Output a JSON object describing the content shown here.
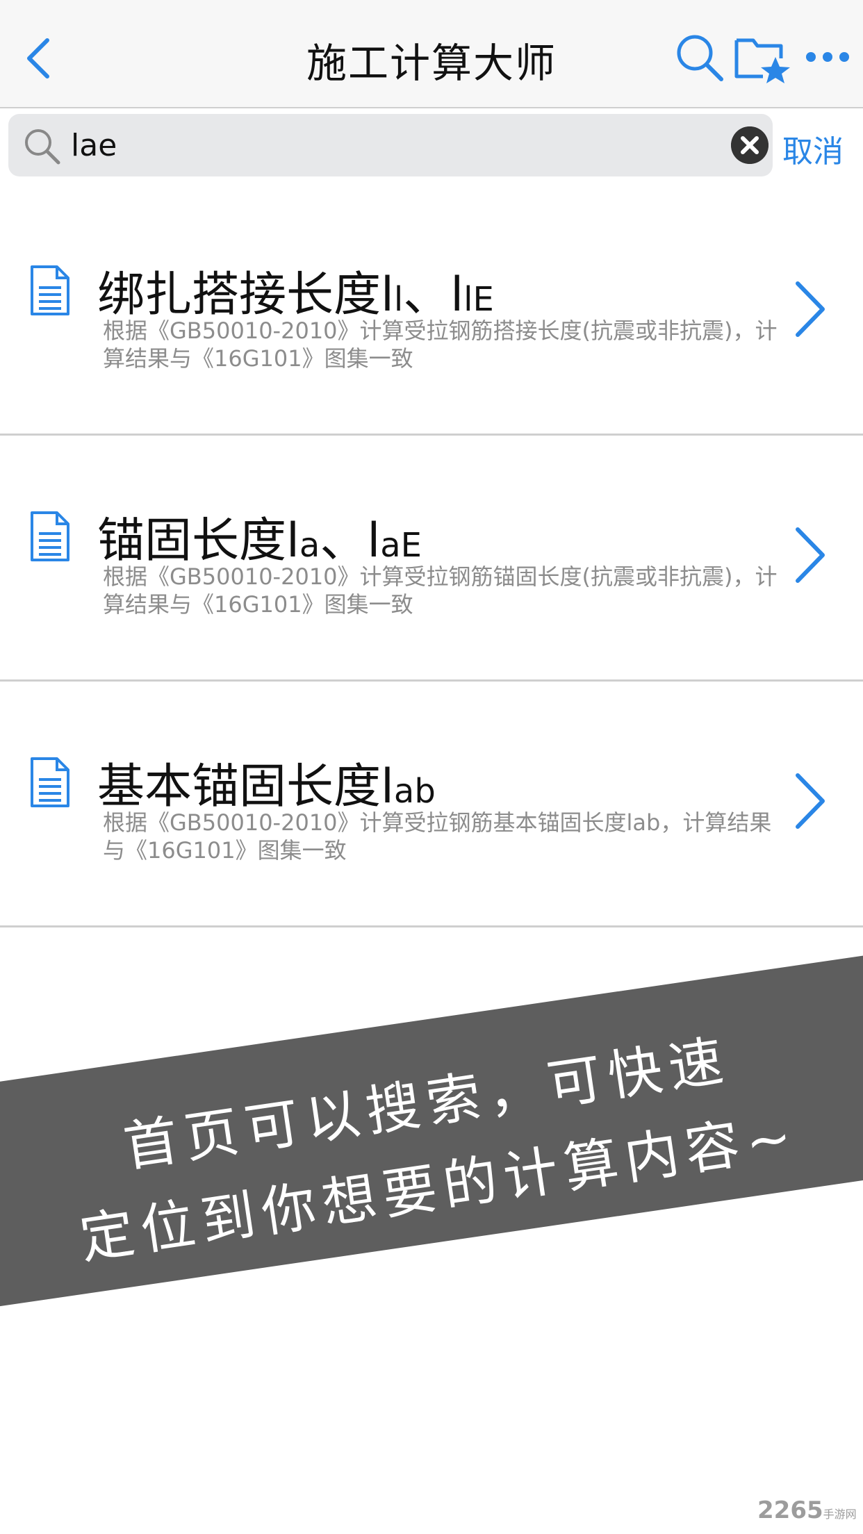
{
  "navbar": {
    "title": "施工计算大师",
    "icons": {
      "back": "chevron-left-icon",
      "search": "search-icon",
      "favorites": "folder-star-icon",
      "more": "more-dots-icon"
    },
    "accent_color": "#2a86e6"
  },
  "search": {
    "query": "lae",
    "cancel_label": "取消"
  },
  "results": [
    {
      "title_main": "绑扎搭接长度l",
      "title_sub1": "l",
      "title_sep": "、l",
      "title_sub2": "lE",
      "description": "根据《GB50010-2010》计算受拉钢筋搭接长度(抗震或非抗震)，计算结果与《16G101》图集一致"
    },
    {
      "title_main": "锚固长度l",
      "title_sub1": "a",
      "title_sep": "、l",
      "title_sub2": "aE",
      "description": "根据《GB50010-2010》计算受拉钢筋锚固长度(抗震或非抗震)，计算结果与《16G101》图集一致"
    },
    {
      "title_main": "基本锚固长度l",
      "title_sub1": "ab",
      "title_sep": "",
      "title_sub2": "",
      "description": "根据《GB50010-2010》计算受拉钢筋基本锚固长度lab，计算结果与《16G101》图集一致"
    }
  ],
  "banner": {
    "line1": "首页可以搜索，可快速",
    "line2": "定位到你想要的计算内容~",
    "background": "#5e5e5e"
  },
  "watermark": {
    "main": "2265",
    "small": "手游网"
  }
}
